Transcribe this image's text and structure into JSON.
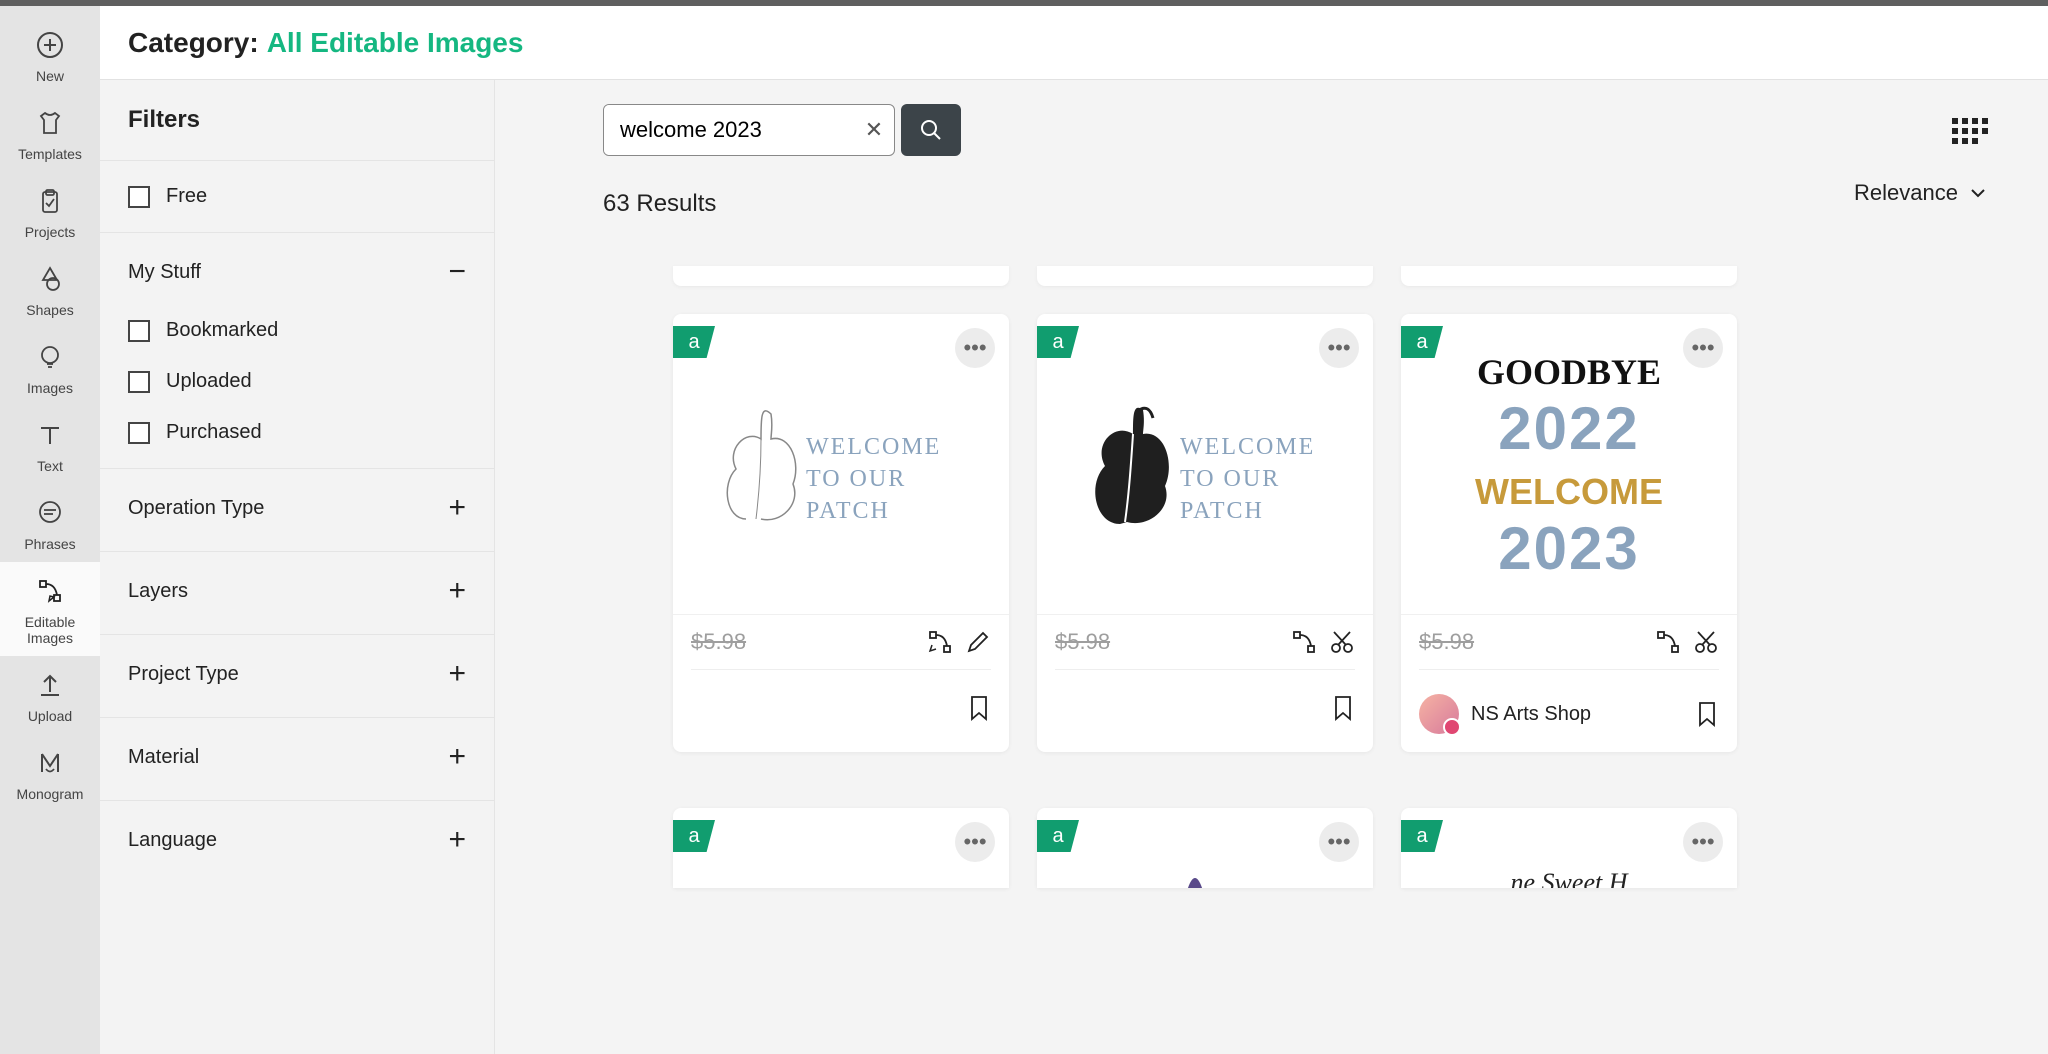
{
  "header": {
    "category_label": "Category:",
    "category_value": "All Editable Images"
  },
  "rail": {
    "new": "New",
    "templates": "Templates",
    "projects": "Projects",
    "shapes": "Shapes",
    "images": "Images",
    "text": "Text",
    "phrases": "Phrases",
    "editable_images_l1": "Editable",
    "editable_images_l2": "Images",
    "upload": "Upload",
    "monogram": "Monogram"
  },
  "filters": {
    "title": "Filters",
    "free": "Free",
    "my_stuff": "My Stuff",
    "bookmarked": "Bookmarked",
    "uploaded": "Uploaded",
    "purchased": "Purchased",
    "operation_type": "Operation Type",
    "layers": "Layers",
    "project_type": "Project Type",
    "material": "Material",
    "language": "Language"
  },
  "search": {
    "value": "welcome 2023"
  },
  "results": {
    "count": "63 Results",
    "sort": "Relevance"
  },
  "cards": [
    {
      "price": "$5.98",
      "author": ""
    },
    {
      "price": "$5.98",
      "author": ""
    },
    {
      "price": "$5.98",
      "author": "NS Arts Shop"
    }
  ]
}
